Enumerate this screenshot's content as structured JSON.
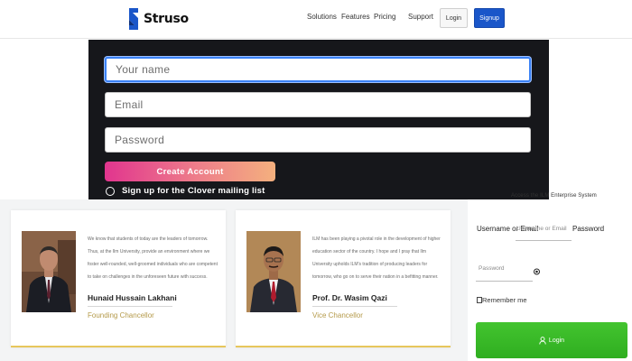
{
  "navbar": {
    "brand": "Struso",
    "links": [
      "Solutions",
      "Features",
      "Pricing",
      "Support"
    ],
    "login_label": "Login",
    "signup_label": "Signup",
    "brand_color": "#1a56c9"
  },
  "signup_form": {
    "name_placeholder": "Your name",
    "email_placeholder": "Email",
    "password_placeholder": "Password",
    "submit_label": "Create Account",
    "mailing_list_label": "Sign up for the Clover mailing list"
  },
  "leaders": [
    {
      "text": "We know that students of today are the leaders of tomorrow. Thus, at the Ilm University, provide an environment where we foster well-rounded, well-groomed individuals who are competent to take on challenges in the unforeseen future with success.",
      "name": "Hunaid Hussain Lakhani",
      "role": "Founding Chancellor"
    },
    {
      "text": "ILM has been playing a pivotal role in the development of higher education sector of the country. I hope and I pray that Ilm University upholds ILM's tradition of producing leaders for tomorrow, who go on to serve their nation in a befitting manner.",
      "name": "Prof. Dr. Wasim Qazi",
      "role": "Vice Chancellor"
    }
  ],
  "login": {
    "heading": "Access the ILM Enterprise System",
    "username_label": "Username or Email",
    "username_placeholder": "Username or Email",
    "password_label": "Password",
    "password_placeholder": "Password",
    "remember_label": "Remember me",
    "button_label": "Login",
    "button_color": "#33b023"
  }
}
